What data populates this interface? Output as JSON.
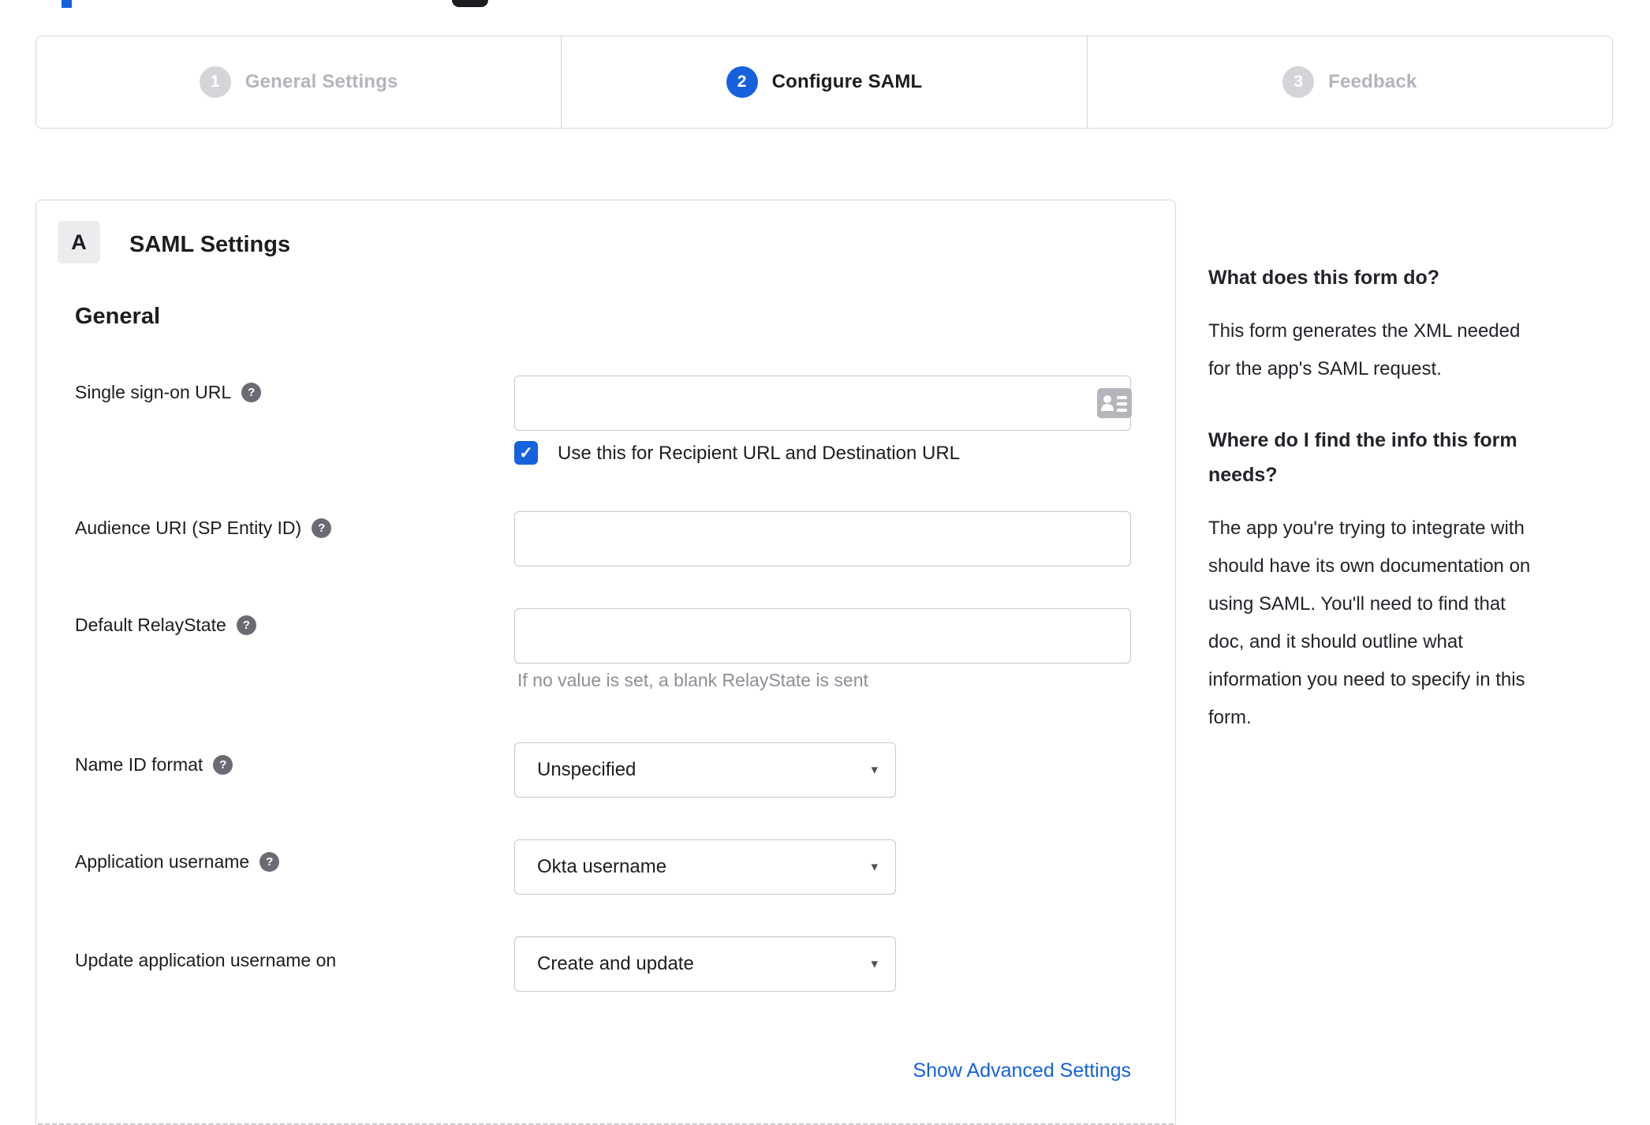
{
  "colors": {
    "accent": "#1662dd",
    "text": "#1d1d21",
    "muted": "#8e8e97",
    "inactive": "#b4b4bc",
    "border": "#d8d8dc",
    "input-border": "#c6c6cd",
    "circle-inactive": "#d4d4d9",
    "help-icon": "#6b6b74",
    "badge-bg": "#ececee",
    "icon-gray": "#b5b5bb"
  },
  "stepper": {
    "active_step": 2,
    "steps": [
      {
        "number": "1",
        "label": "General Settings"
      },
      {
        "number": "2",
        "label": "Configure SAML"
      },
      {
        "number": "3",
        "label": "Feedback"
      }
    ]
  },
  "saml_panel": {
    "section_badge": "A",
    "section_title": "SAML Settings",
    "group_title": "General",
    "fields": {
      "sso_url": {
        "label": "Single sign-on URL",
        "value": ""
      },
      "sso_checkbox": {
        "label": "Use this for Recipient URL and Destination URL",
        "checked": true
      },
      "audience_uri": {
        "label": "Audience URI (SP Entity ID)",
        "value": ""
      },
      "default_relay_state": {
        "label": "Default RelayState",
        "value": "",
        "hint": "If no value is set, a blank RelayState is sent"
      },
      "name_id_format": {
        "label": "Name ID format",
        "selected": "Unspecified"
      },
      "application_username": {
        "label": "Application username",
        "selected": "Okta username"
      },
      "update_application_username_on": {
        "label": "Update application username on",
        "selected": "Create and update"
      }
    },
    "advanced_settings_link": "Show Advanced Settings"
  },
  "help_panel": {
    "sections": [
      {
        "heading": "What does this form do?",
        "body": "This form generates the XML needed\nfor the app's SAML request."
      },
      {
        "heading": "Where do I find the info this form\nneeds?",
        "body": "The app you're trying to integrate with\nshould have its own documentation on\nusing SAML. You'll need to find that\ndoc, and it should outline what\ninformation you need to specify in this\nform."
      }
    ]
  }
}
